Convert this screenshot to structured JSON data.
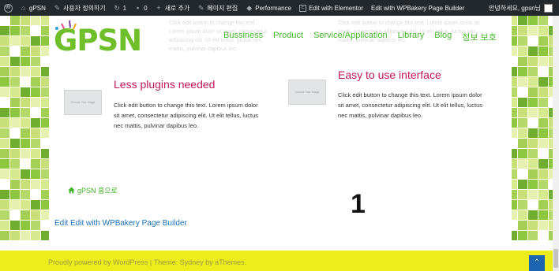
{
  "admin_bar": {
    "site_name": "gPSN",
    "customize": "사용자 정의하기",
    "updates_count": "1",
    "comments_count": "0",
    "new_label": "새로 추가",
    "edit_page": "페이지 편집",
    "performance": "Performance",
    "elementor": "Edit with Elementor",
    "wpbakery": "Edit with WPBakery Page Builder",
    "greeting": "안녕하세요, gpsn님"
  },
  "header": {
    "logo_text": "GPSN",
    "nav": [
      "Bussiness",
      "Product",
      "Service/Application",
      "Library",
      "Blog",
      "정보 보호"
    ]
  },
  "ghost_text": {
    "left": "Click edit button to change this text. Lorem ipsum dolor sit amet, consectetur adipiscing elit. Ut elit tellus, luctus nec mattis, pulvinar dapibus leo.",
    "right": "Click edit button to change this text. Lorem ipsum dolor sit amet, consectetur adipiscing elit. Ut elit tellus, luctus nec mattis, pulvinar dapibus leo."
  },
  "features": [
    {
      "image_label": "Choose Your Image",
      "title": "Less plugins needed",
      "body": "Click edit button to change this text. Lorem ipsum dolor sit amet, consectetur adipiscing elit. Ut elit tellus, luctus nec mattis, pulvinar dapibus leo."
    },
    {
      "image_label": "Choose Your Image",
      "title": "Easy to use interface",
      "body": "Click edit button to change this text. Lorem ipsum dolor sit amet, consectetur adipiscing elit. Ut elit tellus, luctus nec mattis, pulvinar dapibus leo."
    }
  ],
  "home_link": "gPSN 홈으로",
  "big_number": "1",
  "edit_link": "Edit Edit with WPBakery Page Builder",
  "footer": {
    "text": "Proudly powered by WordPress | Theme: Sydney by aThemes."
  },
  "colors": {
    "admin_bar_bg": "#23282d",
    "nav_green": "#48b830",
    "title_pink": "#c2185b",
    "footer_yellow": "#ecee1c",
    "link_blue": "#1e6fb8"
  }
}
